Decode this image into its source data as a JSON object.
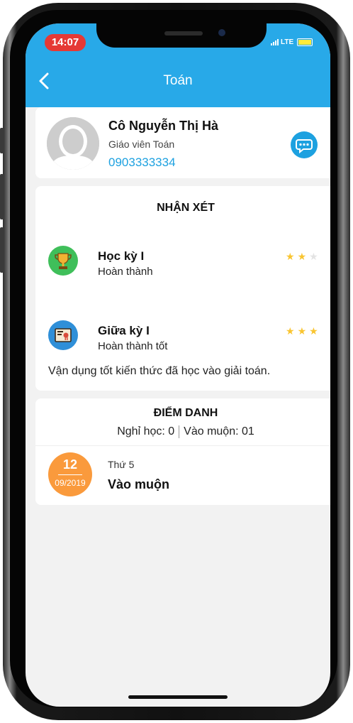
{
  "status_bar": {
    "time": "14:07",
    "network": "LTE"
  },
  "nav": {
    "title": "Toán"
  },
  "teacher": {
    "name": "Cô Nguyễn Thị Hà",
    "role": "Giáo viên Toán",
    "phone": "0903333334"
  },
  "reviews": {
    "title": "NHẬN XÉT",
    "items": [
      {
        "term": "Học kỳ I",
        "result": "Hoàn thành",
        "stars": 2,
        "max_stars": 3,
        "icon": "trophy-icon"
      },
      {
        "term": "Giữa kỳ I",
        "result": "Hoàn thành tốt",
        "stars": 3,
        "max_stars": 3,
        "icon": "certificate-icon"
      }
    ],
    "comment": "Vận dụng tốt kiến thức đã học vào giải toán."
  },
  "attendance": {
    "title": "ĐIỂM DANH",
    "absent_text": "Nghỉ học: 0",
    "late_text": "Vào muộn: 01",
    "records": [
      {
        "day": "12",
        "month": "09/2019",
        "weekday": "Thứ 5",
        "status": "Vào muộn"
      }
    ]
  },
  "colors": {
    "header": "#28a9e8",
    "accent": "#1da1e0",
    "star_filled": "#f9c531",
    "star_empty": "#e3e3e3",
    "date_badge": "#fa9a3c",
    "time_pill": "#e53935"
  }
}
